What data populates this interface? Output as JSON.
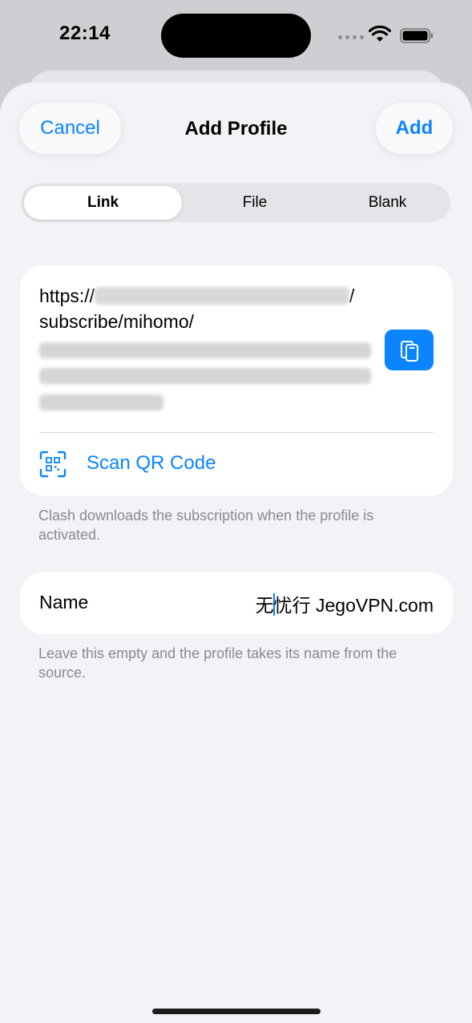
{
  "status_bar": {
    "time": "22:14",
    "icons": [
      "cellular-icon",
      "wifi-icon",
      "battery-icon"
    ]
  },
  "header": {
    "cancel_label": "Cancel",
    "title": "Add Profile",
    "add_label": "Add"
  },
  "tabs": [
    {
      "label": "Link",
      "selected": true
    },
    {
      "label": "File",
      "selected": false
    },
    {
      "label": "Blank",
      "selected": false
    }
  ],
  "link_card": {
    "url_prefix": "https://",
    "url_line2": "subscribe/mihomo/",
    "paste_icon": "clipboard-paste-icon",
    "scan_icon": "qr-code-scan-icon",
    "scan_label": "Scan QR Code"
  },
  "link_footnote": "Clash downloads the subscription when the profile is activated.",
  "name_field": {
    "label": "Name",
    "value_before_cursor": "无",
    "value_after_cursor": "忧行 JegoVPN.com"
  },
  "name_footnote": "Leave this empty and the profile takes its name from the source.",
  "colors": {
    "accent": "#0a84ff",
    "sheet_background": "#f2f2f7",
    "card_background": "#ffffff",
    "footnote_text": "#8a8a8e"
  }
}
